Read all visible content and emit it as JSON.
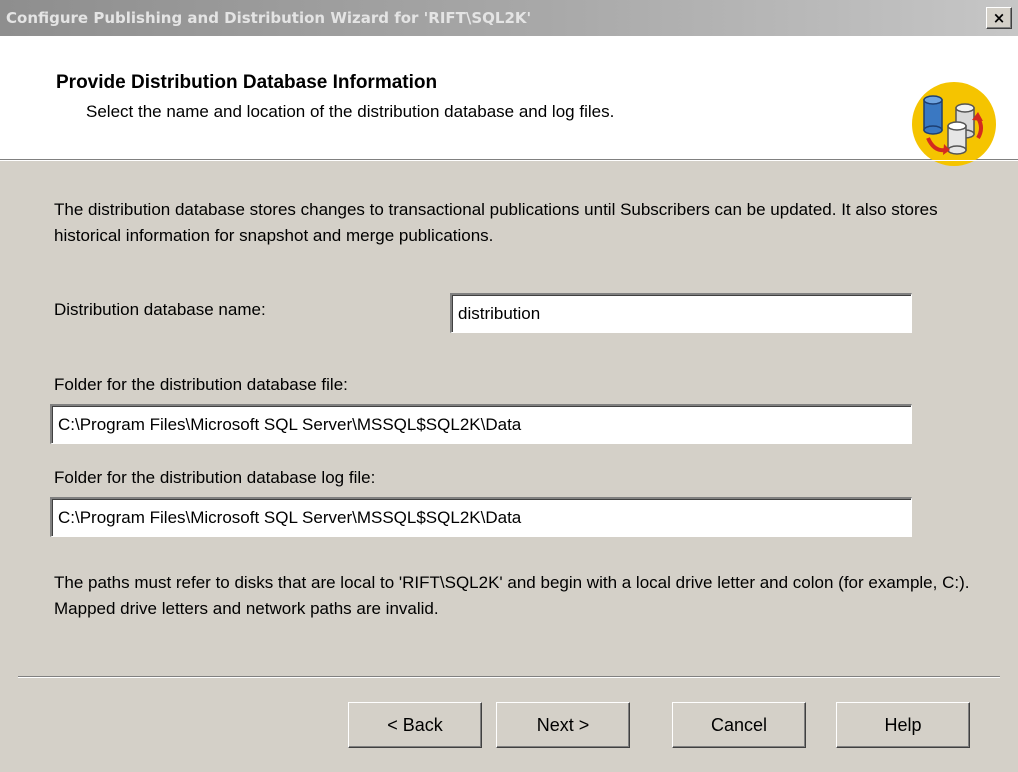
{
  "window": {
    "title": "Configure Publishing and Distribution Wizard for 'RIFT\\SQL2K'",
    "close_glyph": "×"
  },
  "header": {
    "title": "Provide Distribution Database Information",
    "subtitle": "Select the name and location of the distribution database and log files.",
    "icon": "database-replication-icon"
  },
  "body": {
    "description": "The distribution database stores changes to transactional publications until Subscribers can be updated. It also stores historical information for snapshot and merge publications.",
    "db_name_label": "Distribution database name:",
    "db_name_value": "distribution",
    "data_folder_label": "Folder for the distribution database file:",
    "data_folder_value": "C:\\Program Files\\Microsoft SQL Server\\MSSQL$SQL2K\\Data",
    "log_folder_label": "Folder for the distribution database log file:",
    "log_folder_value": "C:\\Program Files\\Microsoft SQL Server\\MSSQL$SQL2K\\Data",
    "note": "The paths must refer to disks that are local to 'RIFT\\SQL2K' and begin with a local drive letter and colon (for example, C:). Mapped drive letters and network paths are invalid."
  },
  "buttons": {
    "back": "< Back",
    "next": "Next >",
    "cancel": "Cancel",
    "help": "Help"
  },
  "colors": {
    "dialog_bg": "#d4d0c8",
    "header_bg": "#ffffff",
    "titlebar_inactive": "#a9a9a9",
    "icon_circle": "#f5c400"
  }
}
